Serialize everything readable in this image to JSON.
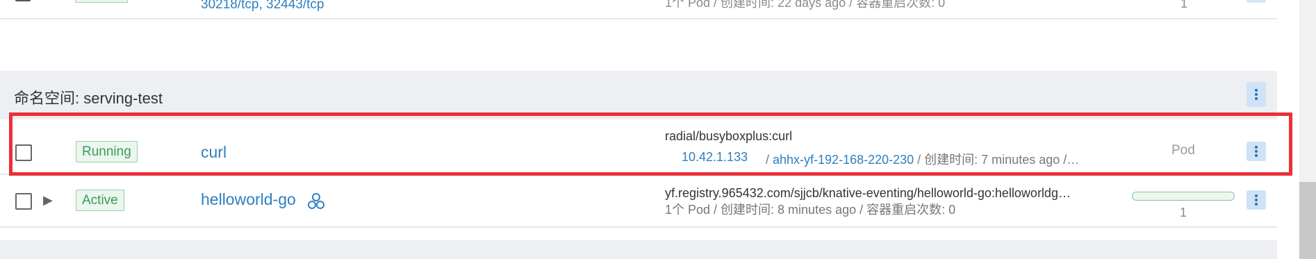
{
  "previous_row": {
    "ports": "30218/tcp, 32443/tcp",
    "meta": "1个 Pod / 创建时间: 22 days ago / 容器重启次数: 0",
    "count": "1"
  },
  "group": {
    "title": "命名空间: serving-test"
  },
  "rows": [
    {
      "status": "Running",
      "name": "curl",
      "image": "radial/busyboxplus:curl",
      "ip": "10.42.1.133",
      "node": "ahhx-yf-192-168-220-230",
      "meta_rest": "/ 创建时间: 7 minutes ago /…",
      "kind": "Pod"
    },
    {
      "status": "Active",
      "name": "helloworld-go",
      "image": "yf.registry.965432.com/sjjcb/knative-eventing/helloworld-go:helloworldg…",
      "meta": "1个 Pod / 创建时间: 8 minutes ago / 容器重启次数: 0",
      "count": "1",
      "progress": 1.0
    }
  ],
  "colors": {
    "accent": "#2e7fbf",
    "status_green": "#3a9b55",
    "highlight": "#e8313a",
    "group_bg": "#edeff2"
  },
  "icons": {
    "row_menu": "kebab-vertical-icon",
    "expand": "triangle-right-icon",
    "service": "cluster-service-icon"
  }
}
